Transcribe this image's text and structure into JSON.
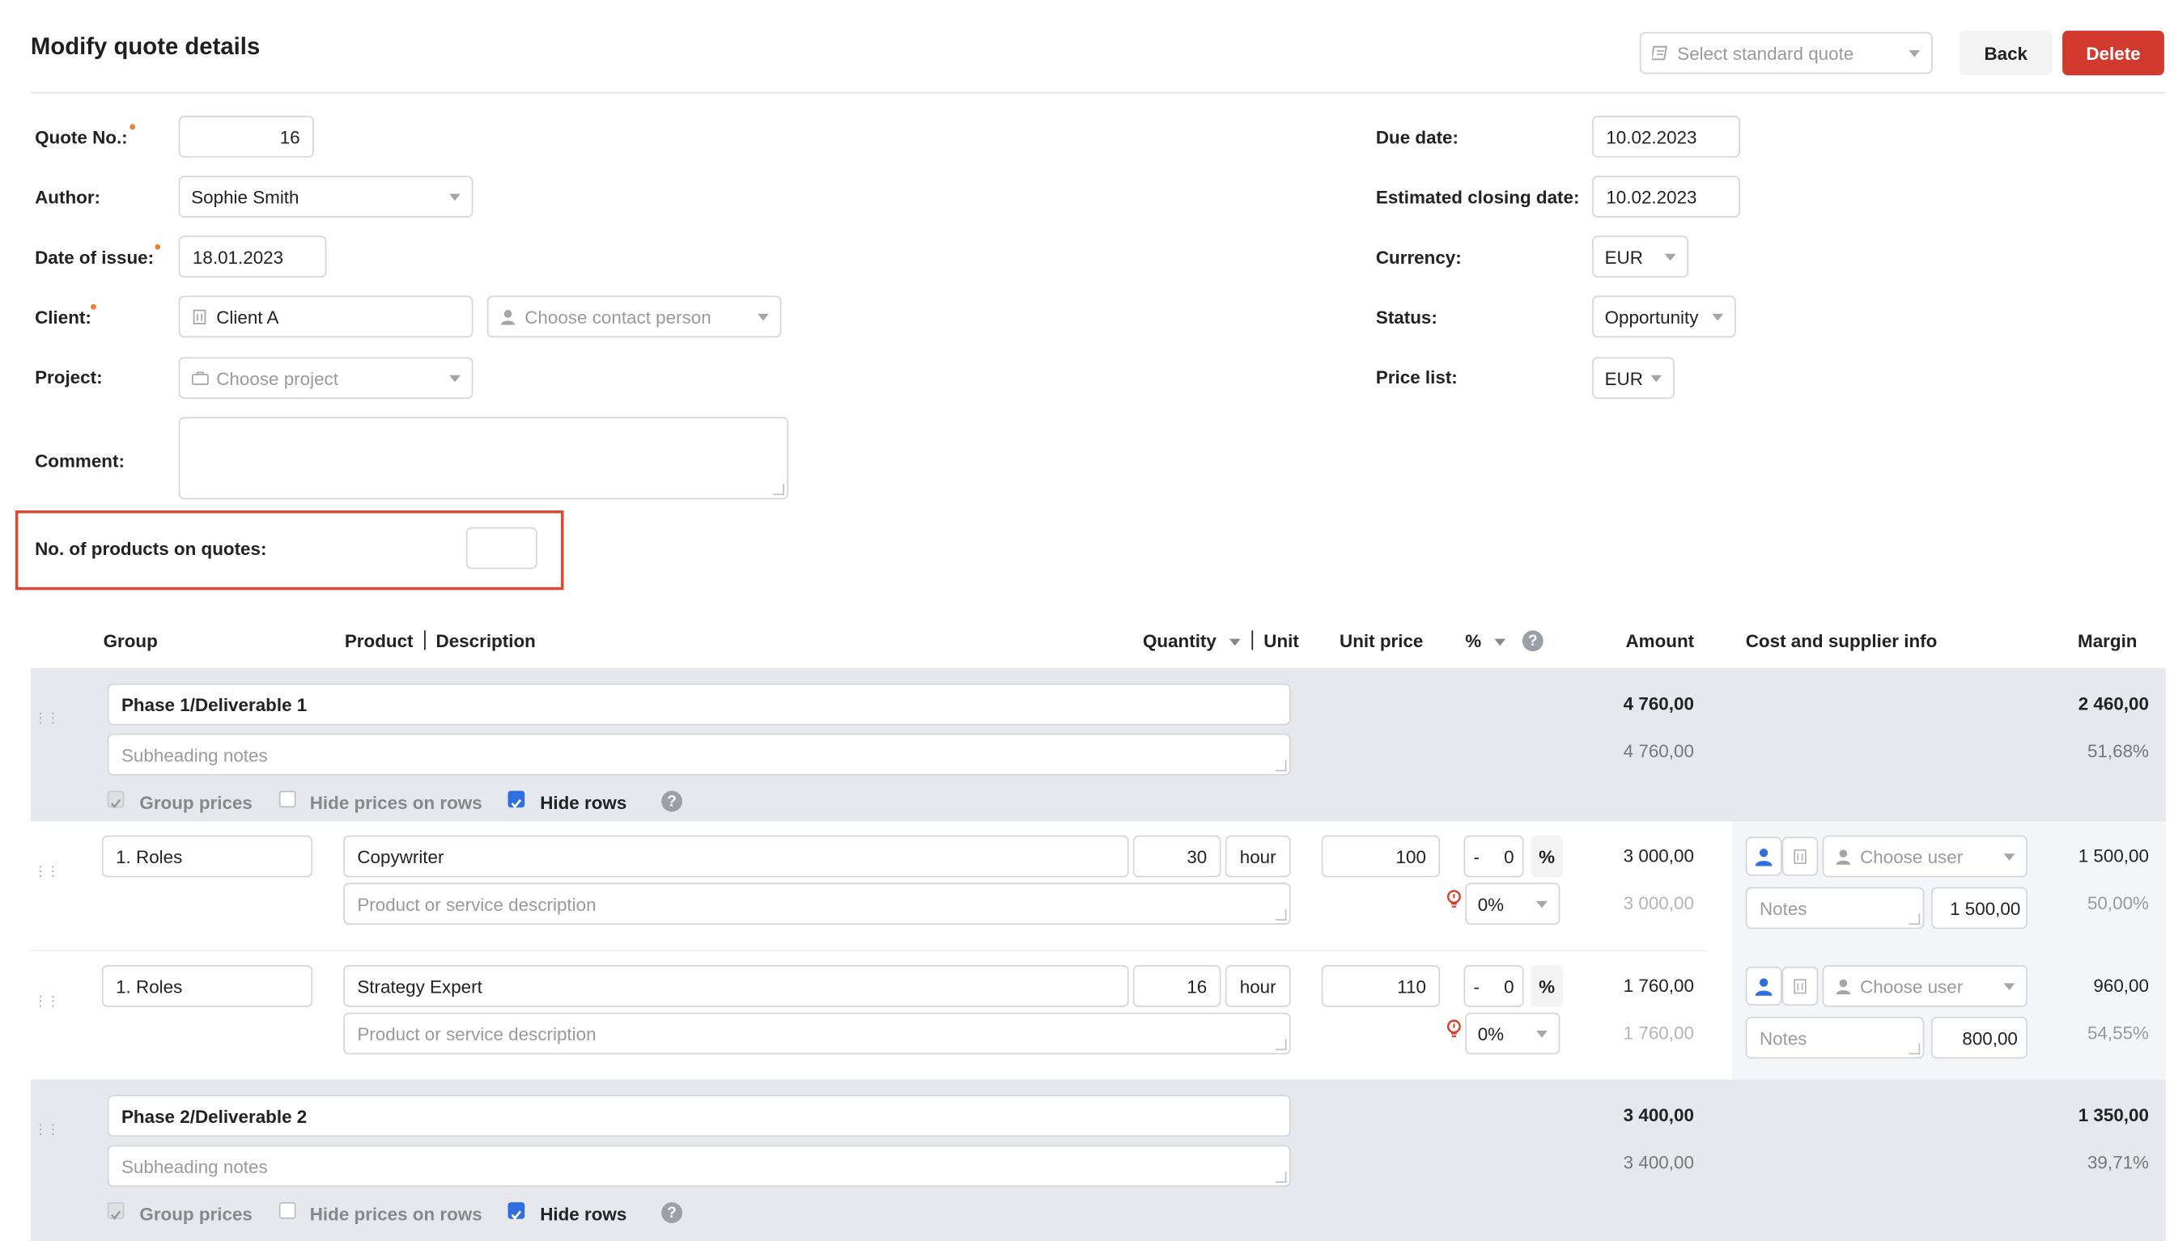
{
  "header": {
    "title": "Modify quote details",
    "standard_quote_placeholder": "Select standard quote",
    "back_label": "Back",
    "delete_label": "Delete"
  },
  "form_left": {
    "quote_no_label": "Quote No.:",
    "quote_no_value": "16",
    "author_label": "Author:",
    "author_value": "Sophie Smith",
    "date_issue_label": "Date of issue:",
    "date_issue_value": "18.01.2023",
    "client_label": "Client:",
    "client_value": "Client A",
    "contact_placeholder": "Choose contact person",
    "project_label": "Project:",
    "project_placeholder": "Choose project",
    "comment_label": "Comment:",
    "comment_value": "",
    "products_count_label": "No. of products on quotes:",
    "products_count_value": ""
  },
  "form_right": {
    "due_date_label": "Due date:",
    "due_date_value": "10.02.2023",
    "closing_date_label": "Estimated closing date:",
    "closing_date_value": "10.02.2023",
    "currency_label": "Currency:",
    "currency_value": "EUR",
    "status_label": "Status:",
    "status_value": "Opportunity",
    "price_list_label": "Price list:",
    "price_list_value": "EUR"
  },
  "table": {
    "headers": {
      "group": "Group",
      "product": "Product",
      "description": "Description",
      "quantity": "Quantity",
      "unit": "Unit",
      "unit_price": "Unit price",
      "percent": "%",
      "amount": "Amount",
      "cost_info": "Cost and supplier info",
      "margin": "Margin"
    },
    "options": {
      "group_prices": "Group prices",
      "hide_prices": "Hide prices on rows",
      "hide_rows": "Hide rows",
      "subheading_placeholder": "Subheading notes",
      "description_placeholder": "Product or service description",
      "notes_placeholder": "Notes",
      "choose_user_placeholder": "Choose user"
    },
    "phases": [
      {
        "title": "Phase 1/Deliverable 1",
        "amount": "4 760,00",
        "amount_sub": "4 760,00",
        "margin": "2 460,00",
        "margin_pct": "51,68%",
        "group_prices_checked": true,
        "hide_prices_checked": false,
        "hide_rows_checked": true
      },
      {
        "title": "Phase 2/Deliverable 2",
        "amount": "3 400,00",
        "amount_sub": "3 400,00",
        "margin": "1 350,00",
        "margin_pct": "39,71%",
        "group_prices_checked": true,
        "hide_prices_checked": false,
        "hide_rows_checked": true
      }
    ],
    "rows": [
      {
        "group": "1. Roles",
        "product": "Copywriter",
        "quantity": "30",
        "unit": "hour",
        "unit_price": "100",
        "discount_sign": "-",
        "discount": "0",
        "discount_unit": "%",
        "vat": "0%",
        "amount": "3 000,00",
        "amount_sub": "3 000,00",
        "cost": "1 500,00",
        "margin": "1 500,00",
        "margin_pct": "50,00%"
      },
      {
        "group": "1. Roles",
        "product": "Strategy Expert",
        "quantity": "16",
        "unit": "hour",
        "unit_price": "110",
        "discount_sign": "-",
        "discount": "0",
        "discount_unit": "%",
        "vat": "0%",
        "amount": "1 760,00",
        "amount_sub": "1 760,00",
        "cost": "800,00",
        "margin": "960,00",
        "margin_pct": "54,55%"
      }
    ]
  },
  "colors": {
    "delete_button": "#d23a2e",
    "highlight_border": "#e0452f",
    "required_dot": "#e8833a",
    "checkbox_checked": "#2f6fe0",
    "phase_band": "#e6e8ee"
  }
}
